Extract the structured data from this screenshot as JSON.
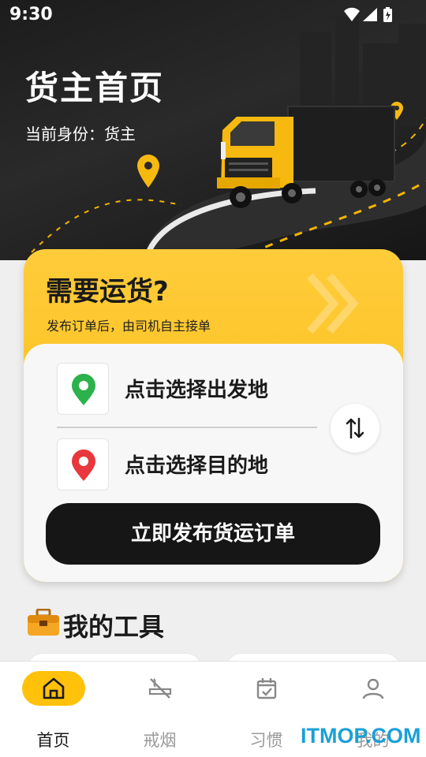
{
  "status": {
    "time": "9:30"
  },
  "hero": {
    "title": "货主首页",
    "identity": "当前身份：货主"
  },
  "card": {
    "title": "需要运货?",
    "subtitle": "发布订单后，由司机自主接单",
    "from_placeholder": "点击选择出发地",
    "to_placeholder": "点击选择目的地",
    "publish_label": "立即发布货运订单"
  },
  "tools": {
    "title": "我的工具"
  },
  "nav": {
    "items": [
      {
        "label": "首页",
        "icon": "home-icon"
      },
      {
        "label": "戒烟",
        "icon": "no-smoking-icon"
      },
      {
        "label": "习惯",
        "icon": "calendar-check-icon"
      },
      {
        "label": "我的",
        "icon": "user-icon"
      }
    ]
  },
  "watermark": "ITMOP.COM",
  "colors": {
    "accent": "#ffc10a",
    "dark": "#161616",
    "pin_green": "#2bb24c",
    "pin_red": "#e8383d"
  }
}
